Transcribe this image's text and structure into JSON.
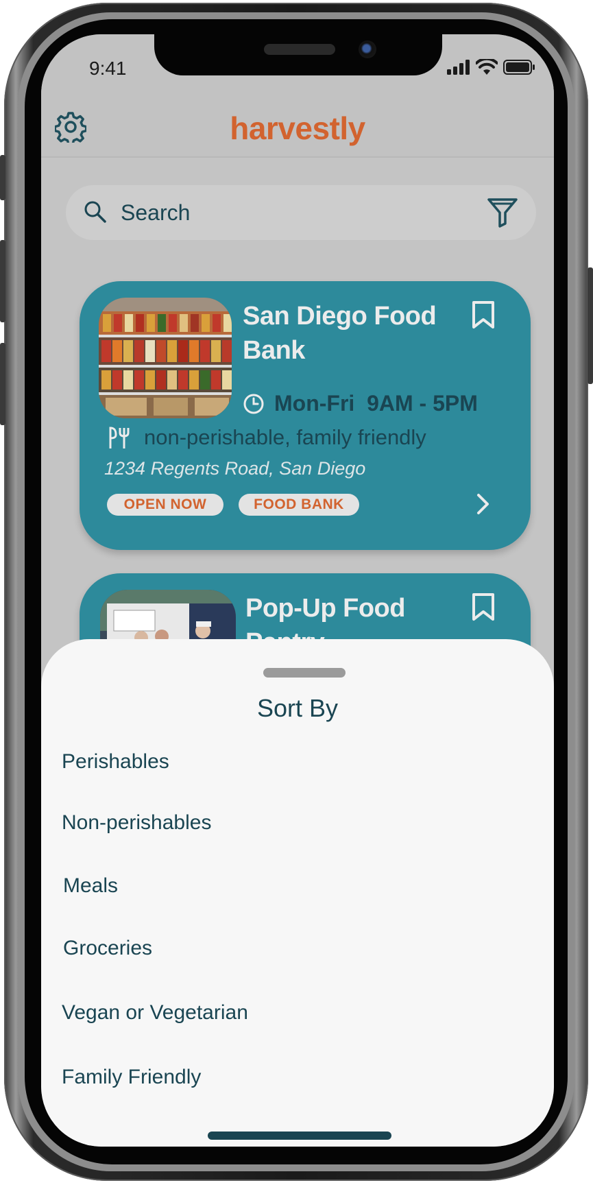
{
  "status_bar": {
    "time": "9:41"
  },
  "header": {
    "app_name": "harvestly"
  },
  "search": {
    "placeholder": "Search"
  },
  "listings": [
    {
      "name": "San Diego Food Bank",
      "hours": "Mon-Fri  9AM - 5PM",
      "categories": "non-perishable, family friendly",
      "address": "1234 Regents Road, San Diego",
      "status_badge": "OPEN NOW",
      "type_badge": "FOOD BANK"
    },
    {
      "name": "Pop-Up Food Pantry"
    }
  ],
  "sort_sheet": {
    "title": "Sort By",
    "options": [
      "Perishables",
      "Non-perishables",
      "Meals",
      "Groceries",
      "Vegan or Vegetarian",
      "Family Friendly"
    ]
  },
  "colors": {
    "brand": "#d2632f",
    "card": "#2d8a9b",
    "text_dark": "#1a4552",
    "sheet": "#f7f7f7"
  }
}
